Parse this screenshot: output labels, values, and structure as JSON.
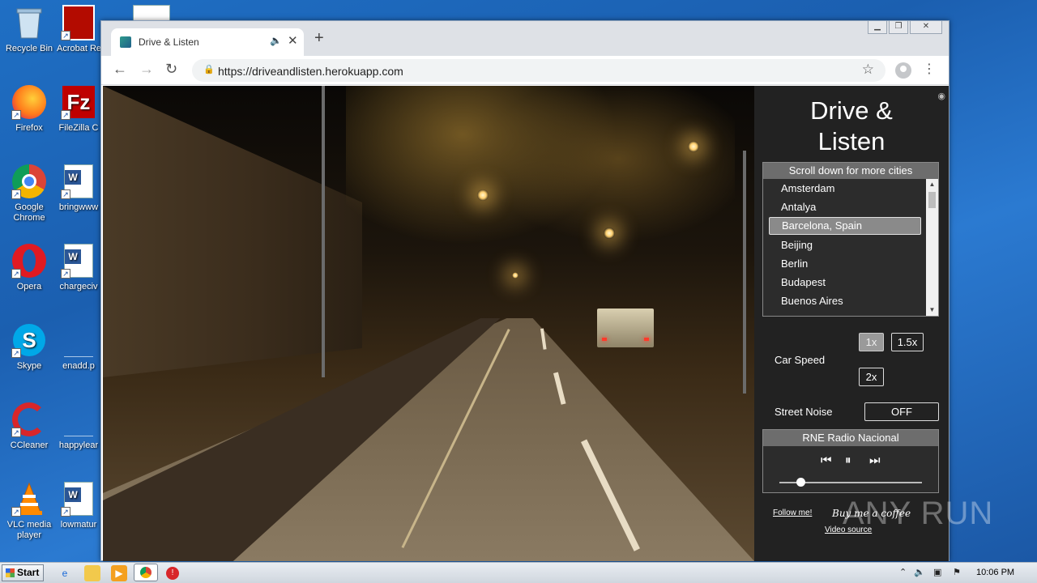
{
  "desktop": {
    "icons": [
      {
        "label": "Recycle Bin",
        "icon": "recycle-bin-icon"
      },
      {
        "label": "Acrobat Reader",
        "icon": "acrobat-icon"
      },
      {
        "label": "Firefox",
        "icon": "firefox-icon"
      },
      {
        "label": "FileZilla C",
        "icon": "filezilla-icon"
      },
      {
        "label": "Google Chrome",
        "icon": "chrome-icon"
      },
      {
        "label": "bringwww",
        "icon": "word-doc-icon"
      },
      {
        "label": "Opera",
        "icon": "opera-icon"
      },
      {
        "label": "chargeciv",
        "icon": "word-doc-icon"
      },
      {
        "label": "Skype",
        "icon": "skype-icon"
      },
      {
        "label": "enadd.p",
        "icon": "file-icon"
      },
      {
        "label": "CCleaner",
        "icon": "ccleaner-icon"
      },
      {
        "label": "happylear",
        "icon": "file-icon"
      },
      {
        "label": "VLC media player",
        "icon": "vlc-icon"
      },
      {
        "label": "lowmatur",
        "icon": "word-doc-icon"
      }
    ]
  },
  "browser": {
    "tab_title": "Drive & Listen",
    "url": "https://driveandlisten.herokuapp.com"
  },
  "app": {
    "title_line1": "Drive &",
    "title_line2": "Listen",
    "city_header": "Scroll down for more cities",
    "cities": [
      "Amsterdam",
      "Antalya",
      "Barcelona, Spain",
      "Beijing",
      "Berlin",
      "Budapest",
      "Buenos Aires"
    ],
    "selected_city": "Barcelona, Spain",
    "car_speed_label": "Car Speed",
    "speed_options": [
      "1x",
      "1.5x",
      "2x"
    ],
    "selected_speed": "1x",
    "street_noise_label": "Street Noise",
    "street_noise_value": "OFF",
    "radio_station": "RNE Radio Nacional",
    "volume": 0.15,
    "follow_link": "Follow me!",
    "coffee_link": "Buy me a coffee",
    "video_source_link": "Video source"
  },
  "watermark": "ANY RUN",
  "taskbar": {
    "start_label": "Start",
    "clock": "10:06 PM"
  }
}
